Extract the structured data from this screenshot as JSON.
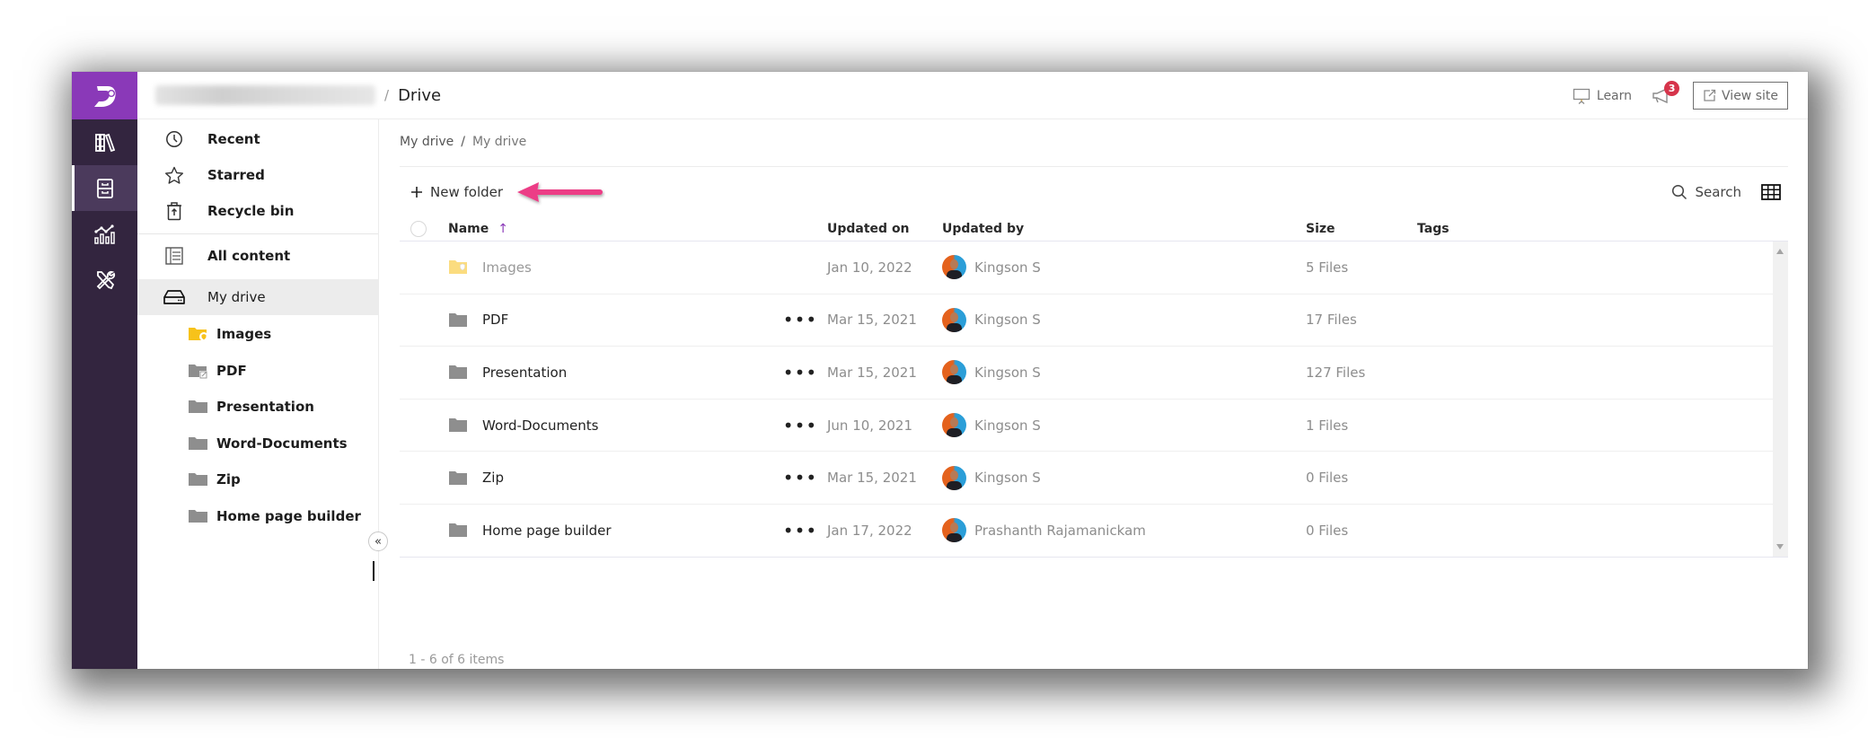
{
  "header": {
    "separator": "/",
    "title": "Drive",
    "learn_label": "Learn",
    "notification_count": "3",
    "view_site_label": "View site"
  },
  "rail": {
    "items": [
      {
        "name": "library",
        "active": false
      },
      {
        "name": "drive",
        "active": true
      },
      {
        "name": "analytics",
        "active": false
      },
      {
        "name": "tools",
        "active": false
      }
    ]
  },
  "sidebar": {
    "items": [
      {
        "label": "Recent",
        "icon": "clock-icon"
      },
      {
        "label": "Starred",
        "icon": "star-icon"
      },
      {
        "label": "Recycle bin",
        "icon": "recycle-bin-icon"
      }
    ],
    "all_content_label": "All content",
    "my_drive_label": "My drive",
    "folders": [
      {
        "label": "Images",
        "icon": "images-folder-icon"
      },
      {
        "label": "PDF",
        "icon": "pdf-folder-icon"
      },
      {
        "label": "Presentation",
        "icon": "folder-icon"
      },
      {
        "label": "Word-Documents",
        "icon": "folder-icon"
      },
      {
        "label": "Zip",
        "icon": "folder-icon"
      },
      {
        "label": "Home page builder",
        "icon": "folder-icon"
      }
    ],
    "collapse_glyph": "«"
  },
  "main": {
    "breadcrumb": [
      "My drive",
      "/",
      "My drive"
    ],
    "new_folder_label": "New folder",
    "search_label": "Search",
    "table": {
      "columns": {
        "name": "Name",
        "updated_on": "Updated on",
        "updated_by": "Updated by",
        "size": "Size",
        "tags": "Tags"
      },
      "sort_indicator": "↑",
      "rows": [
        {
          "name": "Images",
          "updated_on": "Jan 10, 2022",
          "updated_by": "Kingson S",
          "size": "5 Files",
          "tags": "",
          "dimmed": true,
          "has_menu": false
        },
        {
          "name": "PDF",
          "updated_on": "Mar 15, 2021",
          "updated_by": "Kingson S",
          "size": "17 Files",
          "tags": "",
          "dimmed": false,
          "has_menu": true
        },
        {
          "name": "Presentation",
          "updated_on": "Mar 15, 2021",
          "updated_by": "Kingson S",
          "size": "127 Files",
          "tags": "",
          "dimmed": false,
          "has_menu": true
        },
        {
          "name": "Word-Documents",
          "updated_on": "Jun 10, 2021",
          "updated_by": "Kingson S",
          "size": "1 Files",
          "tags": "",
          "dimmed": false,
          "has_menu": true
        },
        {
          "name": "Zip",
          "updated_on": "Mar 15, 2021",
          "updated_by": "Kingson S",
          "size": "0 Files",
          "tags": "",
          "dimmed": false,
          "has_menu": true
        },
        {
          "name": "Home page builder",
          "updated_on": "Jan 17, 2022",
          "updated_by": "Prashanth Rajamanickam",
          "size": "0 Files",
          "tags": "",
          "dimmed": false,
          "has_menu": true
        }
      ],
      "more_glyph": "•••"
    },
    "pager_text": "1 - 6 of 6 items"
  },
  "colors": {
    "brand": "#8a39b8",
    "rail_bg": "#33253f",
    "rail_active": "#4b3a5c",
    "annotation_arrow": "#ec3d86",
    "badge": "#d6344b",
    "images_folder": "#f7c21a"
  }
}
